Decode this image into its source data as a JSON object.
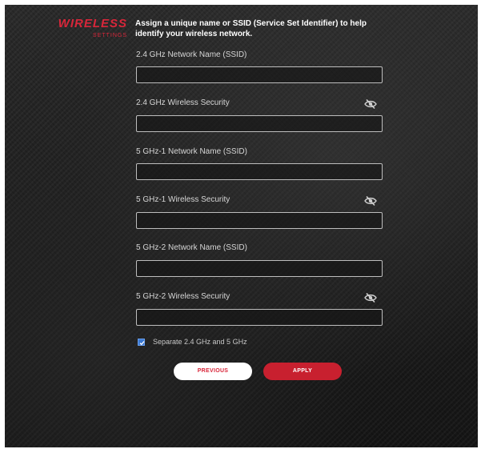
{
  "logo": {
    "title": "WIRELESS",
    "subtitle": "SETTINGS"
  },
  "intro": "Assign a unique name or SSID (Service Set Identifier) to help identify your wireless network.",
  "fields": [
    {
      "label": "2.4 GHz Network Name (SSID)",
      "value": "",
      "has_eye": false
    },
    {
      "label": "2.4 GHz Wireless Security",
      "value": "",
      "has_eye": true
    },
    {
      "label": "5 GHz-1 Network Name (SSID)",
      "value": "",
      "has_eye": false
    },
    {
      "label": "5 GHz-1 Wireless Security",
      "value": "",
      "has_eye": true
    },
    {
      "label": "5 GHz-2 Network Name (SSID)",
      "value": "",
      "has_eye": false
    },
    {
      "label": "5 GHz-2 Wireless Security",
      "value": "",
      "has_eye": true
    }
  ],
  "separate_bands": {
    "label": "Separate 2.4 GHz and 5 GHz",
    "checked": true
  },
  "buttons": {
    "previous": "PREVIOUS",
    "apply": "APPLY"
  },
  "colors": {
    "accent": "#d9263a",
    "checkbox": "#3a78d2"
  },
  "icons": {
    "password_toggle": "eye-slash-icon",
    "checkbox_mark": "checkmark-icon"
  }
}
